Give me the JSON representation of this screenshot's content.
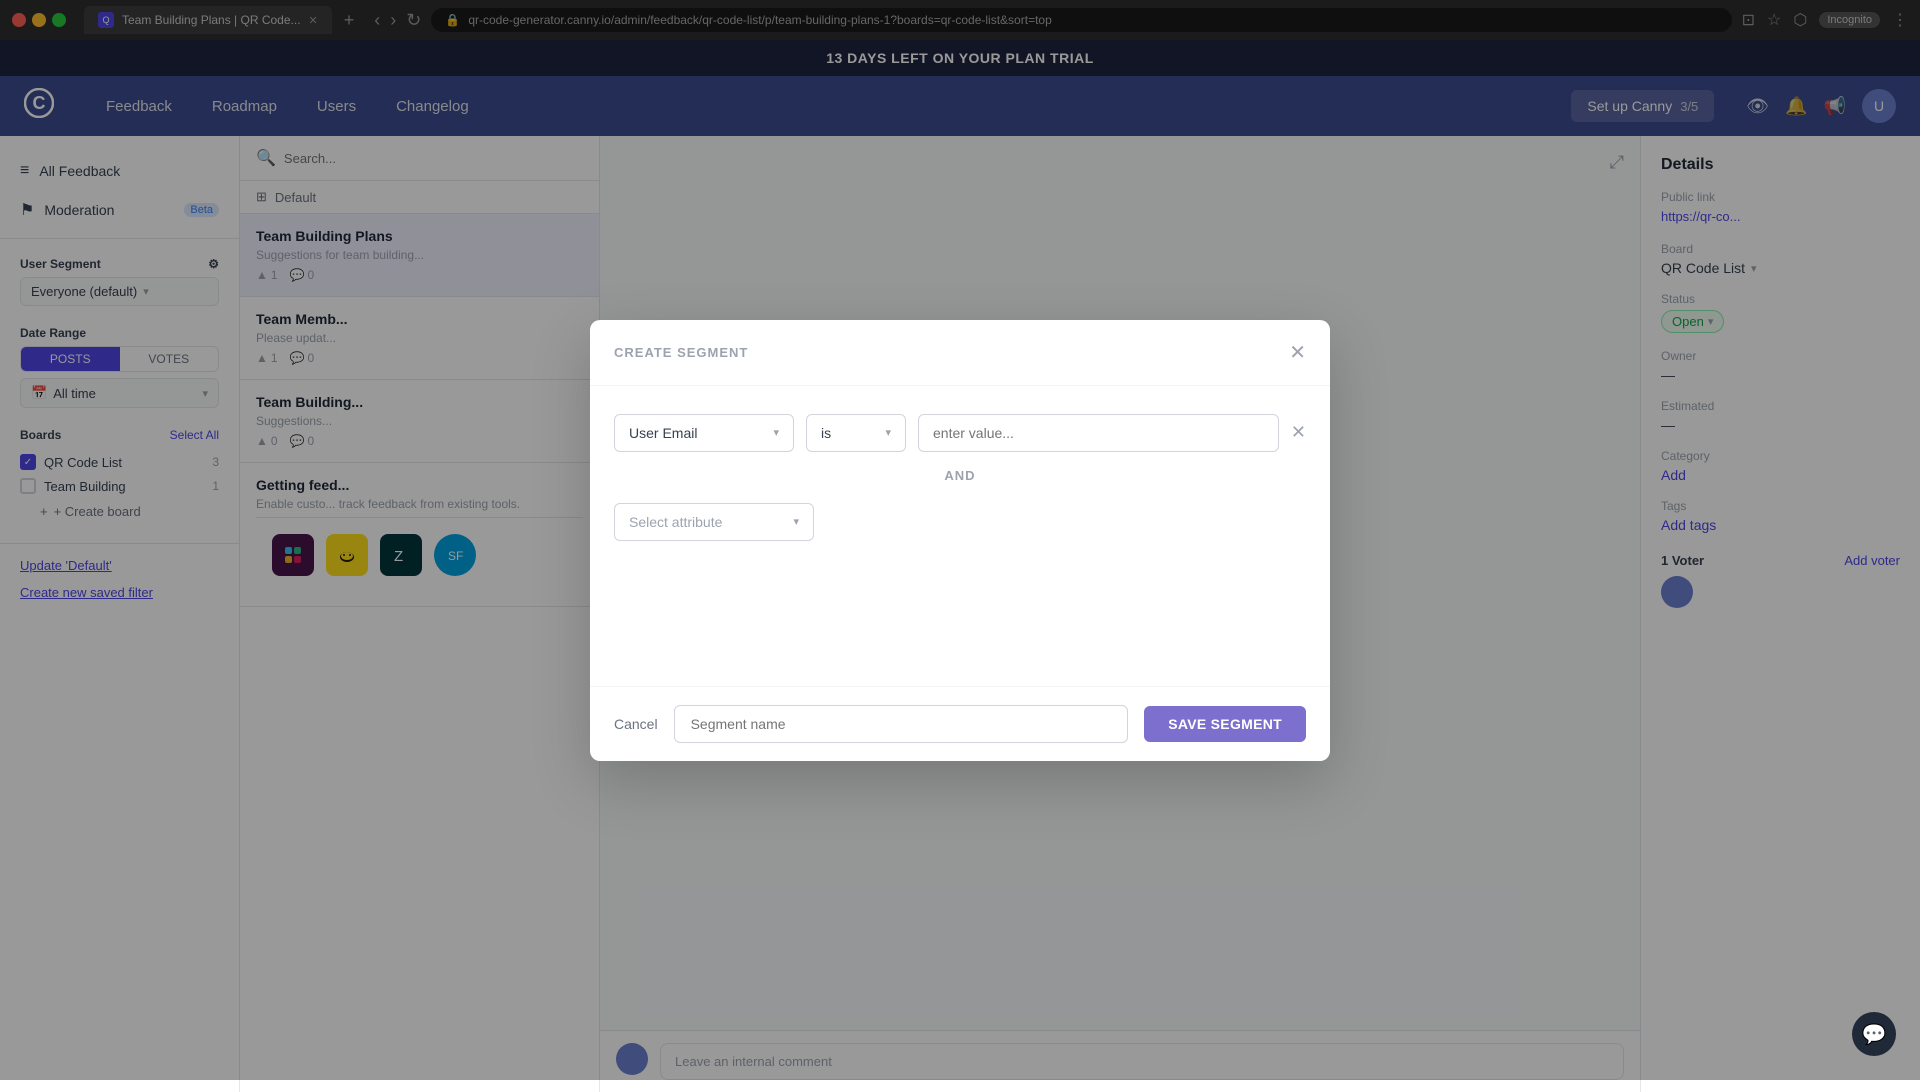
{
  "browser": {
    "tab_title": "Team Building Plans | QR Code...",
    "url": "qr-code-generator.canny.io/admin/feedback/qr-code-list/p/team-building-plans-1?boards=qr-code-list&sort=top",
    "incognito_label": "Incognito"
  },
  "trial_banner": {
    "text": "13 DAYS LEFT ON YOUR PLAN TRIAL"
  },
  "nav": {
    "logo": "C",
    "items": [
      "Feedback",
      "Roadmap",
      "Users",
      "Changelog"
    ],
    "setup_label": "Set up Canny",
    "progress": "3/5"
  },
  "sidebar": {
    "all_feedback_label": "All Feedback",
    "moderation_label": "Moderation",
    "moderation_badge": "Beta",
    "user_segment_label": "User Segment",
    "user_segment_value": "Everyone (default)",
    "date_range_label": "Date Range",
    "date_tabs": [
      "POSTS",
      "VOTES"
    ],
    "date_active_tab": "POSTS",
    "date_value": "All time",
    "boards_label": "Boards",
    "boards_select_all": "Select All",
    "boards": [
      {
        "name": "QR Code List",
        "count": "3",
        "checked": true
      },
      {
        "name": "Team Building",
        "count": "1",
        "checked": false
      }
    ],
    "create_board_label": "+ Create board",
    "update_filter_label": "Update 'Default'",
    "create_filter_label": "Create new saved filter"
  },
  "posts": {
    "search_placeholder": "Search...",
    "filter_label": "Default",
    "items": [
      {
        "title": "Team Building Plans",
        "desc": "Suggestions for team building...",
        "votes": "1",
        "comments": "0"
      },
      {
        "title": "Team Memb...",
        "desc": "Please updat...",
        "votes": "1",
        "comments": "0"
      },
      {
        "title": "Team Building...",
        "desc": "Suggestions...",
        "votes": "0",
        "comments": "0"
      },
      {
        "title": "Getting feed...",
        "desc": "Enable custo... track feedback from existing tools.",
        "votes": "",
        "comments": ""
      }
    ]
  },
  "detail": {
    "title": "Details",
    "public_link_label": "Public link",
    "public_link_value": "https://qr-co...",
    "board_label": "Board",
    "board_value": "QR Code List",
    "status_label": "Status",
    "status_value": "Open",
    "owner_label": "Owner",
    "owner_value": "—",
    "estimated_label": "Estimated",
    "estimated_value": "—",
    "category_label": "Category",
    "category_value": "Add",
    "tags_label": "Tags",
    "tags_value": "Add tags",
    "voters_label": "1 Voter",
    "add_voter_label": "Add voter",
    "comment_placeholder": "Leave an internal comment"
  },
  "integrations": [
    {
      "name": "Slack",
      "emoji": "💬",
      "bg": "#4a154b"
    },
    {
      "name": "Mailchimp",
      "emoji": "🐒",
      "bg": "#ffe01b"
    },
    {
      "name": "Zendesk",
      "emoji": "☀️",
      "bg": "#03363d"
    },
    {
      "name": "Salesforce",
      "emoji": "☁️",
      "bg": "#00a1e0"
    }
  ],
  "modal": {
    "title": "CREATE SEGMENT",
    "row1": {
      "attribute_label": "User Email",
      "operator_label": "is",
      "value_placeholder": "enter value..."
    },
    "and_label": "AND",
    "row2": {
      "attribute_placeholder": "Select attribute"
    },
    "footer": {
      "cancel_label": "Cancel",
      "segment_name_placeholder": "Segment name",
      "save_label": "SAVE SEGMENT"
    }
  },
  "chat_widget_icon": "💬"
}
